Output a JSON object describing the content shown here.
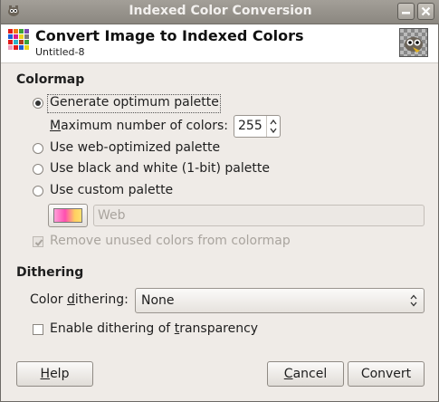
{
  "window": {
    "title": "Indexed Color Conversion"
  },
  "header": {
    "title": "Convert Image to Indexed Colors",
    "subtitle": "Untitled-8"
  },
  "colormap": {
    "heading": "Colormap",
    "optimum": {
      "label": "Generate optimum palette",
      "selected": true
    },
    "max_colors": {
      "label_mnemonic": "M",
      "label_rest": "aximum number of colors:",
      "value": "255"
    },
    "web": {
      "label": "Use web-optimized palette",
      "selected": false
    },
    "bw": {
      "label": "Use black and white (1-bit) palette",
      "selected": false
    },
    "custom": {
      "label": "Use custom palette",
      "selected": false
    },
    "custom_palette_value": "Web",
    "remove_unused": {
      "label": "Remove unused colors from colormap",
      "checked": true,
      "enabled": false
    }
  },
  "dithering": {
    "heading": "Dithering",
    "color_dithering_label_pre": "Color ",
    "color_dithering_label_mnemonic": "d",
    "color_dithering_label_post": "ithering:",
    "color_dithering_value": "None",
    "transparency_pre": "Enable dithering of ",
    "transparency_mnemonic": "t",
    "transparency_post": "ransparency",
    "transparency_checked": false
  },
  "buttons": {
    "help_mnemonic": "H",
    "help_rest": "elp",
    "cancel_mnemonic": "C",
    "cancel_rest": "ancel",
    "convert_label": "Convert"
  },
  "icons": {
    "app": "gimp-icon",
    "minimize": "minimize-icon",
    "close": "close-icon",
    "header": "indexed-palette-icon",
    "thumbnail": "image-thumbnail-icon"
  },
  "colors": {
    "titlebar": "#948f88",
    "radio_dot": "#333333",
    "swatch_pink": "#ff4fb0",
    "swatch_yellow": "#ffe070"
  }
}
